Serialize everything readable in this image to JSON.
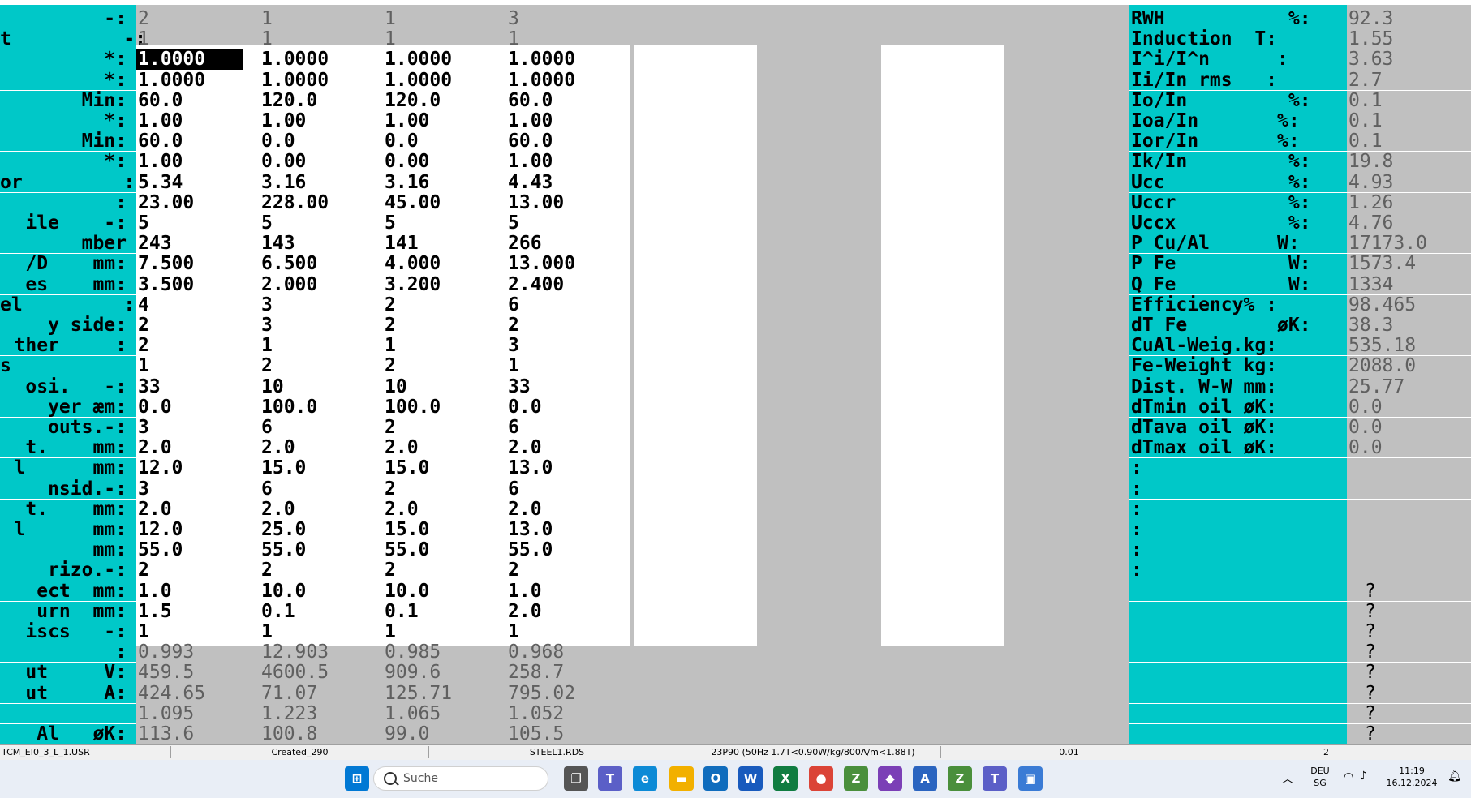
{
  "left_labels": [
    "-:",
    "t          -:",
    "*:",
    "*:",
    "Min:",
    "*:",
    "Min:",
    "*:",
    "or         :",
    ":",
    "ile    -:",
    "mber",
    "/D    mm:",
    "es    mm:",
    "el         :",
    "y side:",
    "ther     :",
    "s             :",
    "osi.   -:",
    "yer æm:",
    "outs.-:",
    "t.    mm:",
    "l      mm:",
    "nsid.-:",
    "t.    mm:",
    "l      mm:",
    "mm:",
    "rizo.-:",
    "ect  mm:",
    "urn  mm:",
    "iscs   -:",
    ":",
    "ut     V:",
    "ut     A:",
    "",
    "Al   øK:"
  ],
  "header_rows": [
    [
      "2",
      "1",
      "1",
      "3"
    ],
    [
      "1",
      "1",
      "1",
      "1"
    ]
  ],
  "input_rows": [
    [
      "1.0000",
      "1.0000",
      "1.0000",
      "1.0000"
    ],
    [
      "1.0000",
      "1.0000",
      "1.0000",
      "1.0000"
    ],
    [
      "60.0",
      "120.0",
      "120.0",
      "60.0"
    ],
    [
      "1.00",
      "1.00",
      "1.00",
      "1.00"
    ],
    [
      "60.0",
      "0.0",
      "0.0",
      "60.0"
    ],
    [
      "1.00",
      "0.00",
      "0.00",
      "1.00"
    ],
    [
      "5.34",
      "3.16",
      "3.16",
      "4.43"
    ],
    [
      "23.00",
      "228.00",
      "45.00",
      "13.00"
    ],
    [
      "5",
      "5",
      "5",
      "5"
    ],
    [
      "243",
      "143",
      "141",
      "266"
    ],
    [
      "7.500",
      "6.500",
      "4.000",
      "13.000"
    ],
    [
      "3.500",
      "2.000",
      "3.200",
      "2.400"
    ],
    [
      "4",
      "3",
      "2",
      "6"
    ],
    [
      "2",
      "3",
      "2",
      "2"
    ],
    [
      "2",
      "1",
      "1",
      "3"
    ],
    [
      "1",
      "2",
      "2",
      "1"
    ],
    [
      "33",
      "10",
      "10",
      "33"
    ],
    [
      "0.0",
      "100.0",
      "100.0",
      "0.0"
    ],
    [
      "3",
      "6",
      "2",
      "6"
    ],
    [
      "2.0",
      "2.0",
      "2.0",
      "2.0"
    ],
    [
      "12.0",
      "15.0",
      "15.0",
      "13.0"
    ],
    [
      "3",
      "6",
      "2",
      "6"
    ],
    [
      "2.0",
      "2.0",
      "2.0",
      "2.0"
    ],
    [
      "12.0",
      "25.0",
      "15.0",
      "13.0"
    ],
    [
      "55.0",
      "55.0",
      "55.0",
      "55.0"
    ],
    [
      "2",
      "2",
      "2",
      "2"
    ],
    [
      "1.0",
      "10.0",
      "10.0",
      "1.0"
    ],
    [
      "1.5",
      "0.1",
      "0.1",
      "2.0"
    ],
    [
      "1",
      "1",
      "1",
      "1"
    ]
  ],
  "output_rows": [
    [
      "0.993",
      "12.903",
      "0.985",
      "0.968"
    ],
    [
      "459.5",
      "4600.5",
      "909.6",
      "258.7"
    ],
    [
      "424.65",
      "71.07",
      "125.71",
      "795.02"
    ],
    [
      "1.095",
      "1.223",
      "1.065",
      "1.052"
    ],
    [
      "113.6",
      "100.8",
      "99.0",
      "105.5"
    ]
  ],
  "results": [
    {
      "label": "RWH           %:",
      "value": "92.3"
    },
    {
      "label": "Induction  T:",
      "value": "1.55"
    },
    {
      "label": "I^i/I^n      :",
      "value": "3.63"
    },
    {
      "label": "Ii/In rms   :",
      "value": "2.7"
    },
    {
      "label": "Io/In         %:",
      "value": "0.1"
    },
    {
      "label": "Ioa/In       %:",
      "value": "0.1"
    },
    {
      "label": "Ior/In       %:",
      "value": "0.1"
    },
    {
      "label": "Ik/In         %:",
      "value": "19.8"
    },
    {
      "label": "Ucc           %:",
      "value": "4.93"
    },
    {
      "label": "Uccr          %:",
      "value": "1.26"
    },
    {
      "label": "Uccx          %:",
      "value": "4.76"
    },
    {
      "label": "P Cu/Al      W:",
      "value": "17173.0"
    },
    {
      "label": "P Fe          W:",
      "value": "1573.4"
    },
    {
      "label": "Q Fe          W:",
      "value": "1334"
    },
    {
      "label": "Efficiency% :",
      "value": "98.465"
    },
    {
      "label": "dT Fe        øK:",
      "value": "38.3"
    },
    {
      "label": "CuAl-Weig.kg:",
      "value": "535.18"
    },
    {
      "label": "Fe-Weight kg:",
      "value": "2088.0"
    },
    {
      "label": "Dist. W-W mm:",
      "value": "25.77"
    },
    {
      "label": "dTmin oil øK:",
      "value": "0.0"
    },
    {
      "label": "dTava oil øK:",
      "value": "0.0"
    },
    {
      "label": "dTmax oil øK:",
      "value": "0.0"
    },
    {
      "label": ":",
      "value": ""
    },
    {
      "label": ":",
      "value": ""
    },
    {
      "label": ":",
      "value": ""
    },
    {
      "label": ":",
      "value": ""
    },
    {
      "label": ":",
      "value": ""
    },
    {
      "label": ":",
      "value": ""
    },
    {
      "label": "",
      "value": "?"
    },
    {
      "label": "",
      "value": "?"
    },
    {
      "label": "",
      "value": "?"
    },
    {
      "label": "",
      "value": "?"
    },
    {
      "label": "",
      "value": "?"
    },
    {
      "label": "",
      "value": "?"
    },
    {
      "label": "",
      "value": "?"
    },
    {
      "label": "",
      "value": "?"
    }
  ],
  "status": [
    "TCM_EI0_3_L_1.USR",
    "Created_290",
    "STEEL1.RDS",
    "23P90  (50Hz 1.7T<0.90W/kg/800A/m<1.88T)",
    "0.01",
    "2"
  ],
  "taskbar": {
    "search_placeholder": "Suche",
    "apps": [
      {
        "icon": "windows-start-icon",
        "color": "#0078d4",
        "glyph": "⊞"
      },
      {
        "icon": "task-view-icon",
        "color": "#555555",
        "glyph": "❐"
      },
      {
        "icon": "teams-icon",
        "color": "#5b5fc7",
        "glyph": "T"
      },
      {
        "icon": "edge-icon",
        "color": "#0c8ad6",
        "glyph": "e"
      },
      {
        "icon": "file-explorer-icon",
        "color": "#f2b000",
        "glyph": "▬"
      },
      {
        "icon": "outlook-icon",
        "color": "#0f6cbd",
        "glyph": "O"
      },
      {
        "icon": "word-icon",
        "color": "#185abd",
        "glyph": "W"
      },
      {
        "icon": "excel-icon",
        "color": "#107c41",
        "glyph": "X"
      },
      {
        "icon": "chrome-icon",
        "color": "#db4437",
        "glyph": "●"
      },
      {
        "icon": "z-app-icon",
        "color": "#4a8f3c",
        "glyph": "Z"
      },
      {
        "icon": "visual-studio-icon",
        "color": "#7b3fb6",
        "glyph": "◆"
      },
      {
        "icon": "a-app-icon",
        "color": "#2a64c0",
        "glyph": "A"
      },
      {
        "icon": "z-app-2-icon",
        "color": "#4a8f3c",
        "glyph": "Z"
      },
      {
        "icon": "teams-2-icon",
        "color": "#5b5fc7",
        "glyph": "T"
      },
      {
        "icon": "active-app-icon",
        "color": "#3a7bd5",
        "glyph": "▣"
      }
    ],
    "lang_top": "DEU",
    "lang_bottom": "SG",
    "time": "11:19",
    "date": "16.12.2024"
  }
}
